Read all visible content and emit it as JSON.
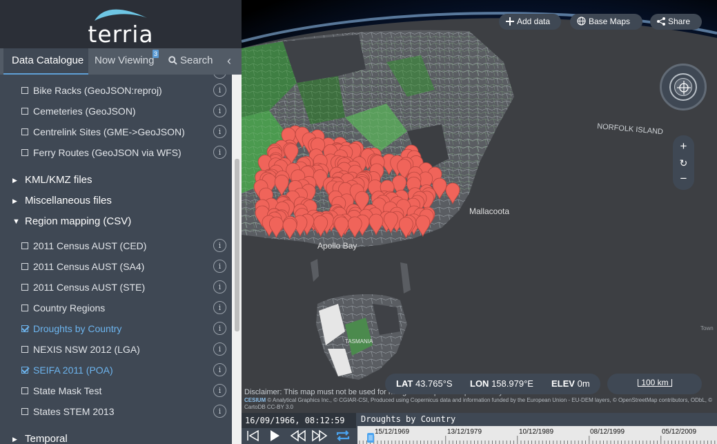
{
  "brand": {
    "name": "terria"
  },
  "tabs": {
    "catalogue": "Data Catalogue",
    "now_viewing": "Now Viewing",
    "now_viewing_count": "3",
    "search": "Search"
  },
  "catalogue": {
    "items_top": [
      {
        "label": "Bike Racks (GeoJSON:reproj)",
        "checked": false
      },
      {
        "label": "Cemeteries (GeoJSON)",
        "checked": false
      },
      {
        "label": "Centrelink Sites (GME->GeoJSON)",
        "checked": false
      },
      {
        "label": "Ferry Routes (GeoJSON via WFS)",
        "checked": false
      }
    ],
    "groups": [
      {
        "label": "KML/KMZ files",
        "open": false
      },
      {
        "label": "Miscellaneous files",
        "open": false
      },
      {
        "label": "Region mapping (CSV)",
        "open": true
      },
      {
        "label": "Temporal",
        "open": false
      }
    ],
    "region_items": [
      {
        "label": "2011 Census AUST (CED)",
        "checked": false
      },
      {
        "label": "2011 Census AUST (SA4)",
        "checked": false
      },
      {
        "label": "2011 Census AUST (STE)",
        "checked": false
      },
      {
        "label": "Country Regions",
        "checked": false
      },
      {
        "label": "Droughts by Country",
        "checked": true
      },
      {
        "label": "NEXIS NSW 2012 (LGA)",
        "checked": false
      },
      {
        "label": "SEIFA 2011 (POA)",
        "checked": true
      },
      {
        "label": "State Mask Test",
        "checked": false
      },
      {
        "label": "States STEM 2013",
        "checked": false
      }
    ],
    "info_glyph": "i"
  },
  "map": {
    "add_data": "Add data",
    "base_maps": "Base Maps",
    "share": "Share",
    "zoom_in": "+",
    "zoom_reset": "↻",
    "zoom_out": "−",
    "labels": {
      "norfolk_island": "NORFOLK ISLAND",
      "mallacoota": "Mallacoota",
      "apollo_bay": "Apollo Bay",
      "tasmania": "TASMANIA",
      "town": "Town"
    },
    "coords": {
      "lat_label": "LAT",
      "lat_value": "43.765°S",
      "lon_label": "LON",
      "lon_value": "158.979°E",
      "elev_label": "ELEV",
      "elev_value": "0m"
    },
    "scale": "100 km",
    "disclaimer": "Disclaimer: This map must not be used for navigation or precise spatial analysis",
    "credits_brand": "CESIUM",
    "credits": "© Analytical Graphics Inc., © CGIAR-CSI, Produced using Copernicus data and information funded by the European Union - EU-DEM layers, © OpenStreetMap contributors, ODbL, © CartoDB CC-BY 3.0"
  },
  "timeline": {
    "current_time": "16/09/1966, 08:12:59",
    "layer": "Droughts by Country",
    "ticks": [
      "15/12/1969",
      "13/12/1979",
      "10/12/1989",
      "08/12/1999",
      "05/12/2009"
    ]
  },
  "colors": {
    "sidebar_bg": "#3f4854",
    "accent": "#6db5ef",
    "marker": "#f0645a",
    "region_green": "#3f8a45"
  }
}
